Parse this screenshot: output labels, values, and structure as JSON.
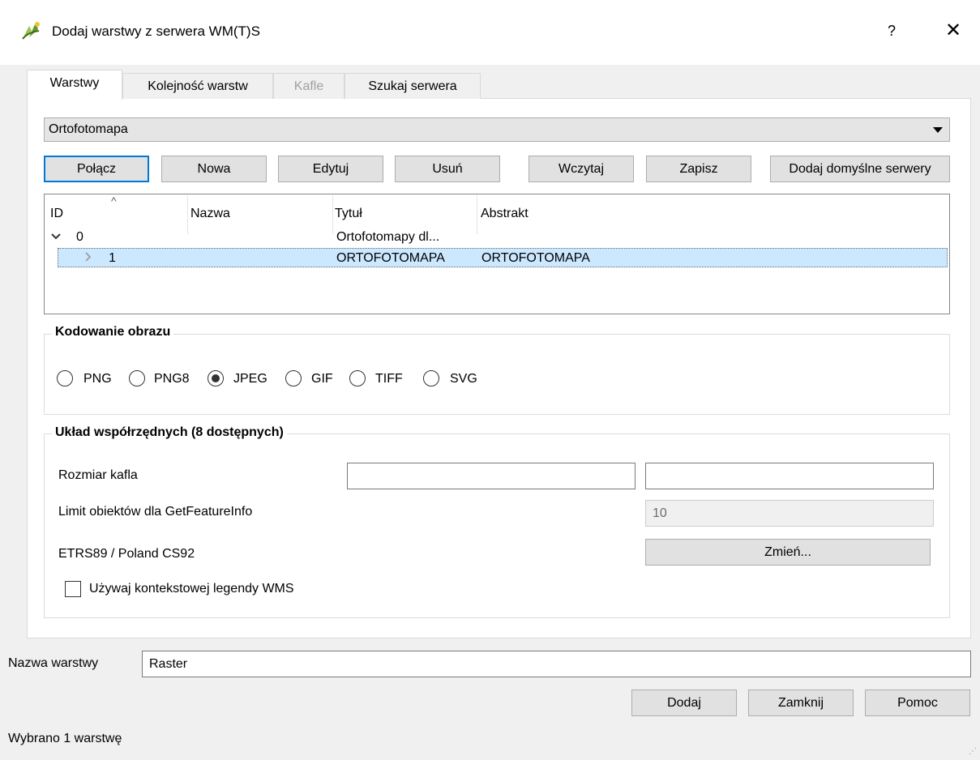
{
  "window": {
    "title": "Dodaj warstwy z serwera WM(T)S",
    "help_label": "?",
    "close_label": "✕"
  },
  "tabs": [
    {
      "label": "Warstwy",
      "active": true,
      "enabled": true
    },
    {
      "label": "Kolejność warstw",
      "active": false,
      "enabled": true
    },
    {
      "label": "Kafle",
      "active": false,
      "enabled": false
    },
    {
      "label": "Szukaj serwera",
      "active": false,
      "enabled": true
    }
  ],
  "server": {
    "selected": "Ortofotomapa"
  },
  "connection_buttons": {
    "connect": "Połącz",
    "new": "Nowa",
    "edit": "Edytuj",
    "remove": "Usuń",
    "load": "Wczytaj",
    "save": "Zapisz",
    "add_default": "Dodaj domyślne serwery"
  },
  "layer_table": {
    "columns": [
      "ID",
      "Nazwa",
      "Tytuł",
      "Abstrakt"
    ],
    "rows": [
      {
        "id": "0",
        "name": "",
        "title": "Ortofotomapy dl...",
        "abstract": "",
        "expanded": true,
        "level": 0
      },
      {
        "id": "1",
        "name": "",
        "title": "ORTOFOTOMAPA",
        "abstract": "ORTOFOTOMAPA",
        "expanded": false,
        "level": 1,
        "selected": true
      }
    ]
  },
  "image_encoding": {
    "title": "Kodowanie obrazu",
    "options": [
      "PNG",
      "PNG8",
      "JPEG",
      "GIF",
      "TIFF",
      "SVG"
    ],
    "selected": "JPEG"
  },
  "crs": {
    "title": "Układ współrzędnych (8 dostępnych)",
    "tile_size_label": "Rozmiar kafla",
    "tile_width": "",
    "tile_height": "",
    "feature_limit_label": "Limit obiektów dla GetFeatureInfo",
    "feature_limit_value": "10",
    "crs_name": "ETRS89 / Poland CS92",
    "change_label": "Zmień...",
    "contextual_legend_label": "Używaj kontekstowej legendy WMS",
    "contextual_legend_checked": false
  },
  "layer_name": {
    "label": "Nazwa warstwy",
    "value": "Raster"
  },
  "dialog_buttons": {
    "add": "Dodaj",
    "close": "Zamknij",
    "help": "Pomoc"
  },
  "status": "Wybrano 1 warstwę",
  "icons": {
    "app": "qgis-icon",
    "expand": "chevron-down-icon",
    "collapse": "chevron-right-icon",
    "combo_arrow": "caret-down-icon"
  }
}
